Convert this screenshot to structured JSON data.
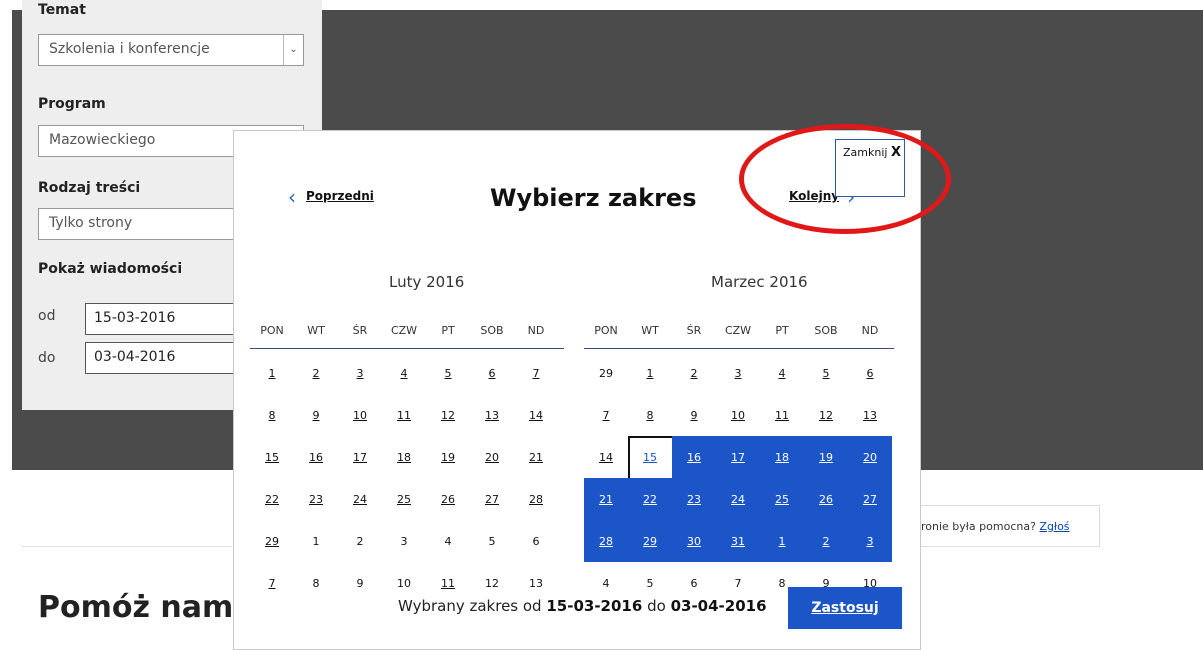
{
  "filters": {
    "topic_label": "Temat",
    "topic_value": "Szkolenia i konferencje",
    "program_label": "Program",
    "program_value": "Mazowieckiego",
    "content_type_label": "Rodzaj treści",
    "content_type_value": "Tylko strony",
    "show_news_label": "Pokaż wiadomości",
    "from_label": "od",
    "from_value": "15-03-2016",
    "to_label": "do",
    "to_value": "03-04-2016"
  },
  "background": {
    "helpful_text": "ronie była pomocna?",
    "report_link": "Zgłoś",
    "help_heading": "Pomóż nam"
  },
  "modal": {
    "title": "Wybierz zakres",
    "prev_label": "Poprzedni",
    "next_label": "Kolejny",
    "close_label": "Zamknij",
    "close_x": "X",
    "weekdays": [
      "PON",
      "WT",
      "ŚR",
      "CZW",
      "PT",
      "SOB",
      "ND"
    ],
    "months": [
      {
        "title": "Luty 2016",
        "days": [
          {
            "d": "1",
            "link": true
          },
          {
            "d": "2",
            "link": true
          },
          {
            "d": "3",
            "link": true
          },
          {
            "d": "4",
            "link": true
          },
          {
            "d": "5",
            "link": true
          },
          {
            "d": "6",
            "link": true
          },
          {
            "d": "7",
            "link": true
          },
          {
            "d": "8",
            "link": true
          },
          {
            "d": "9",
            "link": true
          },
          {
            "d": "10",
            "link": true
          },
          {
            "d": "11",
            "link": true
          },
          {
            "d": "12",
            "link": true
          },
          {
            "d": "13",
            "link": true
          },
          {
            "d": "14",
            "link": true
          },
          {
            "d": "15",
            "link": true
          },
          {
            "d": "16",
            "link": true
          },
          {
            "d": "17",
            "link": true
          },
          {
            "d": "18",
            "link": true
          },
          {
            "d": "19",
            "link": true
          },
          {
            "d": "20",
            "link": true
          },
          {
            "d": "21",
            "link": true
          },
          {
            "d": "22",
            "link": true
          },
          {
            "d": "23",
            "link": true
          },
          {
            "d": "24",
            "link": true
          },
          {
            "d": "25",
            "link": true
          },
          {
            "d": "26",
            "link": true
          },
          {
            "d": "27",
            "link": true
          },
          {
            "d": "28",
            "link": true
          },
          {
            "d": "29",
            "link": true
          },
          {
            "d": "1"
          },
          {
            "d": "2"
          },
          {
            "d": "3"
          },
          {
            "d": "4"
          },
          {
            "d": "5"
          },
          {
            "d": "6"
          },
          {
            "d": "7",
            "link": true
          },
          {
            "d": "8"
          },
          {
            "d": "9"
          },
          {
            "d": "10"
          },
          {
            "d": "11",
            "link": true
          },
          {
            "d": "12"
          },
          {
            "d": "13"
          }
        ]
      },
      {
        "title": "Marzec 2016",
        "days": [
          {
            "d": "29"
          },
          {
            "d": "1",
            "link": true
          },
          {
            "d": "2",
            "link": true
          },
          {
            "d": "3",
            "link": true
          },
          {
            "d": "4",
            "link": true
          },
          {
            "d": "5",
            "link": true
          },
          {
            "d": "6",
            "link": true
          },
          {
            "d": "7",
            "link": true
          },
          {
            "d": "8",
            "link": true
          },
          {
            "d": "9",
            "link": true
          },
          {
            "d": "10",
            "link": true
          },
          {
            "d": "11",
            "link": true
          },
          {
            "d": "12",
            "link": true
          },
          {
            "d": "13",
            "link": true
          },
          {
            "d": "14",
            "link": true
          },
          {
            "d": "15",
            "link": true,
            "start": true
          },
          {
            "d": "16",
            "link": true,
            "range": true
          },
          {
            "d": "17",
            "link": true,
            "range": true
          },
          {
            "d": "18",
            "link": true,
            "range": true
          },
          {
            "d": "19",
            "link": true,
            "range": true
          },
          {
            "d": "20",
            "link": true,
            "range": true
          },
          {
            "d": "21",
            "link": true,
            "range": true
          },
          {
            "d": "22",
            "link": true,
            "range": true
          },
          {
            "d": "23",
            "link": true,
            "range": true
          },
          {
            "d": "24",
            "link": true,
            "range": true
          },
          {
            "d": "25",
            "link": true,
            "range": true
          },
          {
            "d": "26",
            "link": true,
            "range": true
          },
          {
            "d": "27",
            "link": true,
            "range": true
          },
          {
            "d": "28",
            "link": true,
            "range": true
          },
          {
            "d": "29",
            "link": true,
            "range": true
          },
          {
            "d": "30",
            "link": true,
            "range": true
          },
          {
            "d": "31",
            "link": true,
            "range": true
          },
          {
            "d": "1",
            "link": true,
            "range": true
          },
          {
            "d": "2",
            "link": true,
            "range": true
          },
          {
            "d": "3",
            "link": true,
            "range": true
          },
          {
            "d": "4"
          },
          {
            "d": "5"
          },
          {
            "d": "6"
          },
          {
            "d": "7"
          },
          {
            "d": "8"
          },
          {
            "d": "9"
          },
          {
            "d": "10"
          }
        ]
      }
    ],
    "range_prefix": "Wybrany zakres od",
    "range_from": "15-03-2016",
    "range_mid": "do",
    "range_to": "03-04-2016",
    "apply_label": "Zastosuj"
  },
  "colors": {
    "range_fill": "#1c55c8",
    "annotation_ring": "#e01818",
    "backdrop": "#4b4b4b"
  }
}
